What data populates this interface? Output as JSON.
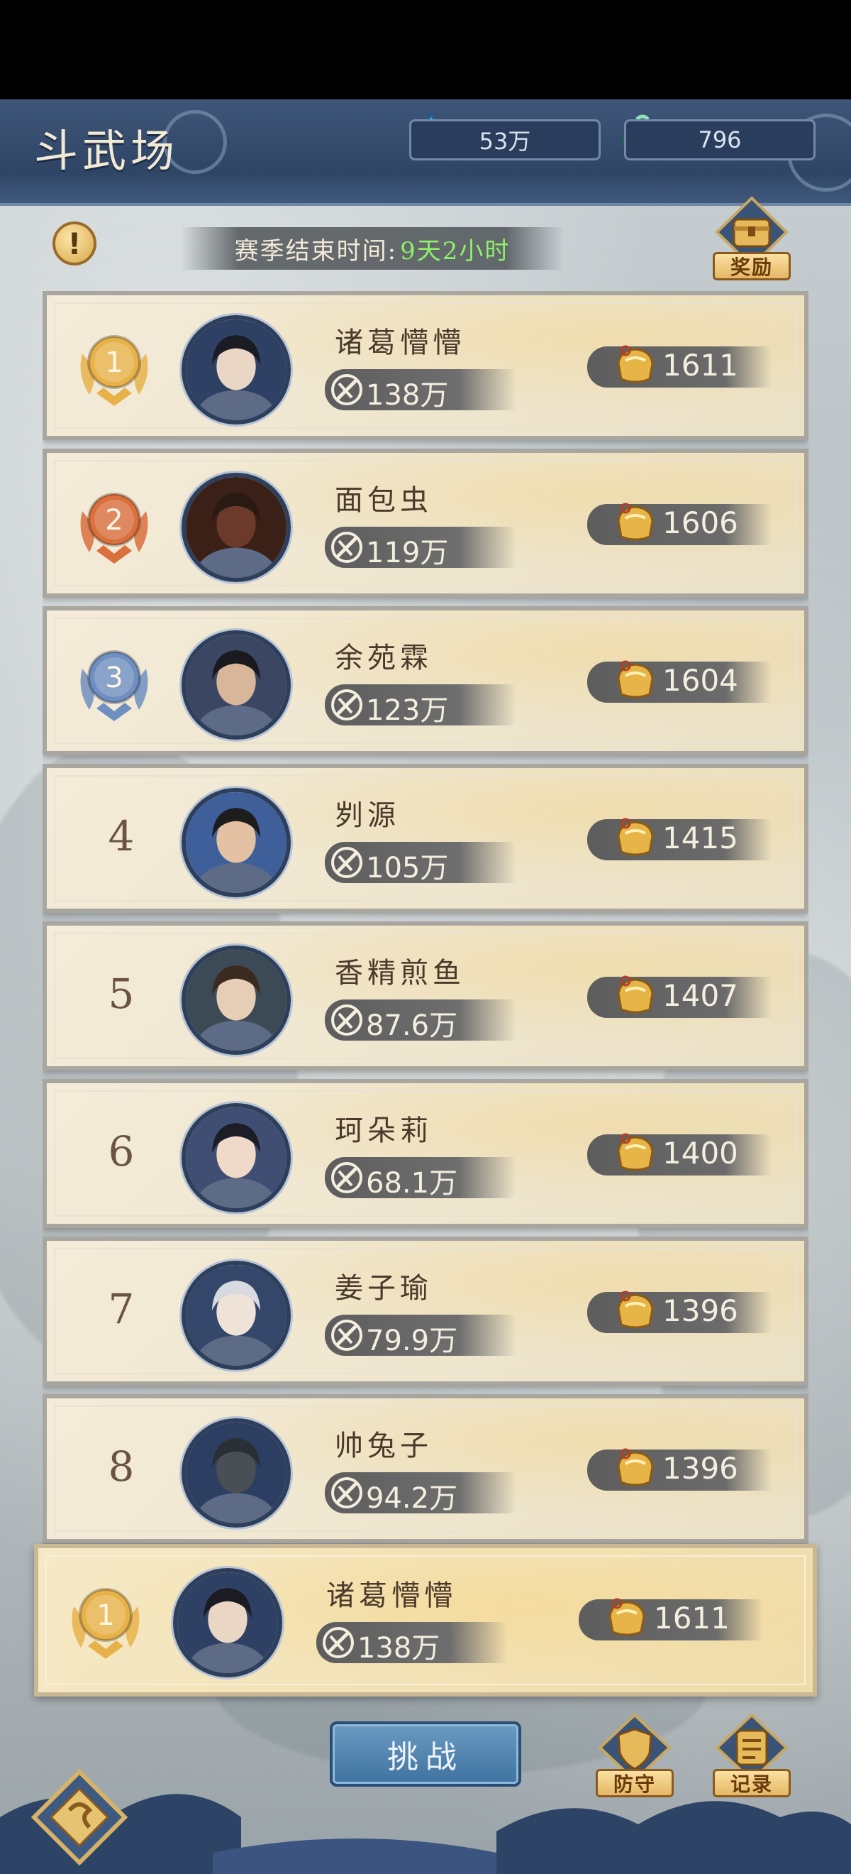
{
  "header": {
    "title": "斗武场",
    "crystal_amount": "53万",
    "jade_amount": "796"
  },
  "season": {
    "label": "赛季结束时间:",
    "remaining": "9天2小时"
  },
  "buttons": {
    "alert": "!",
    "reward": "奖励",
    "challenge": "挑战",
    "defense": "防守",
    "record": "记录"
  },
  "rankings": [
    {
      "rank": "1",
      "name": "诸葛懵懵",
      "power": "138万",
      "score": "1611",
      "medal": "gold"
    },
    {
      "rank": "2",
      "name": "面包虫",
      "power": "119万",
      "score": "1606",
      "medal": "bronze"
    },
    {
      "rank": "3",
      "name": "余苑霖",
      "power": "123万",
      "score": "1604",
      "medal": "blue"
    },
    {
      "rank": "4",
      "name": "刿源",
      "power": "105万",
      "score": "1415",
      "medal": ""
    },
    {
      "rank": "5",
      "name": "香精煎鱼",
      "power": "87.6万",
      "score": "1407",
      "medal": ""
    },
    {
      "rank": "6",
      "name": "珂朵莉",
      "power": "68.1万",
      "score": "1400",
      "medal": ""
    },
    {
      "rank": "7",
      "name": "姜子瑜",
      "power": "79.9万",
      "score": "1396",
      "medal": ""
    },
    {
      "rank": "8",
      "name": "帅兔子",
      "power": "94.2万",
      "score": "1396",
      "medal": ""
    }
  ],
  "my_rank": {
    "rank": "1",
    "name": "诸葛懵懵",
    "power": "138万",
    "score": "1611",
    "medal": "gold"
  },
  "colors": {
    "gold_medal": "#e8b24a",
    "bronze_medal": "#d9703e",
    "blue_medal": "#6f8fc0",
    "remaining_time": "#8ff06a"
  }
}
